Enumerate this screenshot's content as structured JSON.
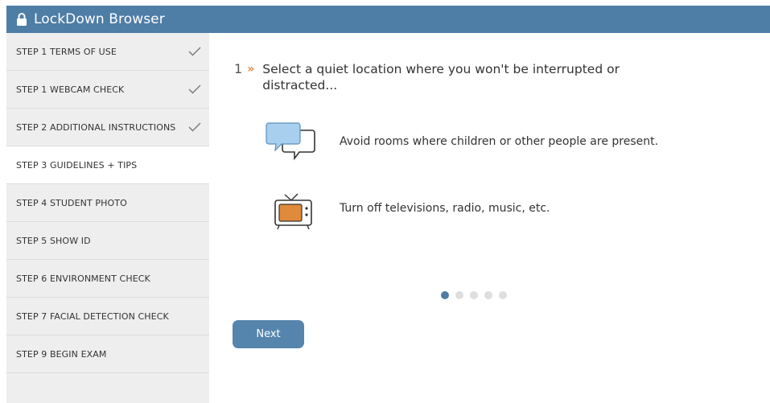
{
  "window": {
    "title": "LockDown Browser"
  },
  "sidebar": {
    "items": [
      {
        "label": "STEP 1 TERMS OF USE",
        "done": true,
        "active": false
      },
      {
        "label": "STEP 1 WEBCAM CHECK",
        "done": true,
        "active": false
      },
      {
        "label": "STEP 2 ADDITIONAL INSTRUCTIONS",
        "done": true,
        "active": false
      },
      {
        "label": "STEP 3 GUIDELINES + TIPS",
        "done": false,
        "active": true
      },
      {
        "label": "STEP 4 STUDENT PHOTO",
        "done": false,
        "active": false
      },
      {
        "label": "STEP 5 SHOW ID",
        "done": false,
        "active": false
      },
      {
        "label": "STEP 6 ENVIRONMENT CHECK",
        "done": false,
        "active": false
      },
      {
        "label": "STEP 7 FACIAL DETECTION CHECK",
        "done": false,
        "active": false
      },
      {
        "label": "STEP 9 BEGIN EXAM",
        "done": false,
        "active": false
      }
    ]
  },
  "main": {
    "step_number": "1",
    "step_marker": "»",
    "heading": "Select a quiet location where you won't be interrupted or distracted...",
    "tips": [
      {
        "icon": "chat-bubbles-icon",
        "text": "Avoid rooms where children or other people are present."
      },
      {
        "icon": "television-icon",
        "text": "Turn off televisions, radio, music, etc."
      }
    ],
    "pager": {
      "total": 5,
      "current": 1
    },
    "next_label": "Next"
  },
  "colors": {
    "accent": "#4e7da6",
    "button": "#5585ad",
    "marker": "#e08a3c",
    "sidebar_bg": "#eeeeee",
    "active_row": "#ffffff"
  }
}
